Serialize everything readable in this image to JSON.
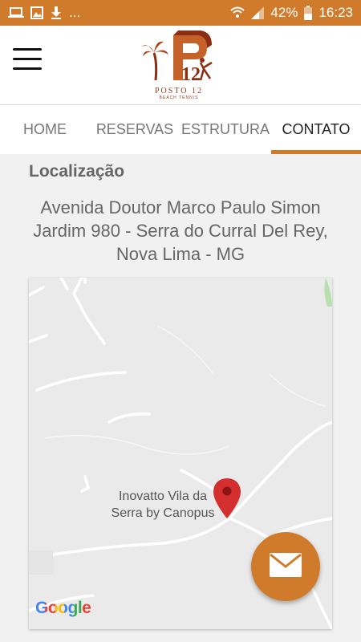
{
  "status_bar": {
    "battery_percent": "42%",
    "time": "16:23",
    "overflow_dots": "...",
    "background_color": "#d07a2c",
    "icons": [
      "laptop-icon",
      "image-icon",
      "download-icon",
      "wifi-icon",
      "signal-icon",
      "battery-icon"
    ]
  },
  "header": {
    "logo_text": "POSTO 12",
    "logo_subtext": "BEACH TENNIS",
    "logo_number": "12"
  },
  "tabs": [
    {
      "label": "HOME",
      "active": false
    },
    {
      "label": "RESERVAS",
      "active": false
    },
    {
      "label": "ESTRUTURA",
      "active": false
    },
    {
      "label": "CONTATO",
      "active": true
    }
  ],
  "section": {
    "title": "Localização",
    "address": "Avenida Doutor Marco Paulo Simon Jardim 980 - Serra do Curral Del Rey, Nova Lima - MG"
  },
  "map": {
    "place_label_line1": "Inovatto Vila da",
    "place_label_line2": "Serra by Canopus",
    "attribution": "Google",
    "pin_color": "#d32f2f",
    "background_color": "#ebeaea"
  },
  "fab": {
    "icon": "mail-icon",
    "color": "#d07a2c"
  }
}
